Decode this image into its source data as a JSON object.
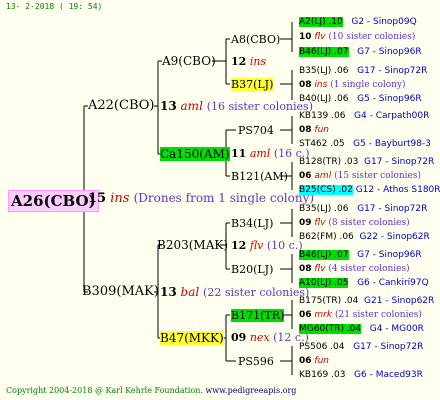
{
  "header": {
    "date_text": "13-  2-2018  ( 19: 54)"
  },
  "footer": {
    "copyright": "Copyright 2004-2018 @ Karl Kehrle Foundation.",
    "url": "www.pedigreeapis.org"
  },
  "root": {
    "label": "A26(CBO)"
  },
  "gen1": {
    "a22": "A22(CBO)",
    "b309": "B309(MAK)",
    "num": "15",
    "race": "ins",
    "note": "(Drones from 1 single colony)"
  },
  "gen2": {
    "a9": "A9(CBO)",
    "num13a": "13",
    "race_a": "aml",
    "note_a": "(16 sister colonies)",
    "b203": "B203(MAK)",
    "num13b": "13",
    "race_b": "bal",
    "note_b": "(22 sister colonies)"
  },
  "gen3": {
    "a8": "A8(CBO)",
    "n12a": "12",
    "ins": "ins",
    "b37": "B37(LJ)",
    "ps704": "PS704",
    "n11": "11",
    "aml": "aml",
    "note_11": "(16 c.)",
    "ca150": "Ca150(AM)",
    "b121": "B121(AM)",
    "b34": "B34(LJ)",
    "n12b": "12",
    "flv": "flv",
    "note_12": "(10 c.)",
    "b20": "B20(LJ)",
    "b171": "B171(TR)",
    "n09": "09",
    "nex": "nex",
    "note_09": "(12 c.)",
    "b47": "B47(MKK)",
    "ps596": "PS596"
  },
  "gen4": [
    {
      "queen": "A2(LJ) .10",
      "code": "G2 - Sinop09Q"
    },
    {
      "num": "10",
      "race": "flv",
      "note": "(10 sister colonies)"
    },
    {
      "queen": "B46(LJ) .07",
      "code": "G7 - Sinop96R"
    },
    {
      "queen": "B35(LJ) .06",
      "code": "G17 - Sinop72R"
    },
    {
      "num": "08",
      "race": "ins",
      "note": "(1 single colony)"
    },
    {
      "queen": "B40(LJ) .06",
      "code": "G5 - Sinop96R"
    },
    {
      "queen": "KB139 .06",
      "code": "G4 - Carpath00R"
    },
    {
      "num": "08",
      "race": "fun",
      "note": ""
    },
    {
      "queen": "ST462 .05",
      "code": "G5 - Bayburt98-3"
    },
    {
      "queen": "B128(TR) .03",
      "code": "G17 - Sinop72R"
    },
    {
      "num": "06",
      "race": "aml",
      "note": "(15 sister colonies)"
    },
    {
      "queen": "B25(CS) .02",
      "code": "G12 - Athos S180R"
    },
    {
      "queen": "B35(LJ) .06",
      "code": "G17 - Sinop72R"
    },
    {
      "num": "09",
      "race": "flv",
      "note": "(8 sister colonies)"
    },
    {
      "queen": "B62(FM) .06",
      "code": "G22 - Sinop62R"
    },
    {
      "queen": "B46(LJ) .07",
      "code": "G7 - Sinop96R"
    },
    {
      "num": "08",
      "race": "flv",
      "note": "(4 sister colonies)"
    },
    {
      "queen": "A10(LJ) .05",
      "code": "G6 - Cankiri97Q"
    },
    {
      "queen": "B175(TR) .04",
      "code": "G21 - Sinop62R"
    },
    {
      "num": "06",
      "race": "mrk",
      "note": "(21 sister colonies)"
    },
    {
      "queen": "MG60(TR) .04",
      "code": "G4 - MG00R"
    },
    {
      "queen": "PS506 .04",
      "code": "G17 - Sinop72R"
    },
    {
      "num": "06",
      "race": "fun",
      "note": ""
    },
    {
      "queen": "KB169 .03",
      "code": "G6 - Maced93R"
    }
  ]
}
